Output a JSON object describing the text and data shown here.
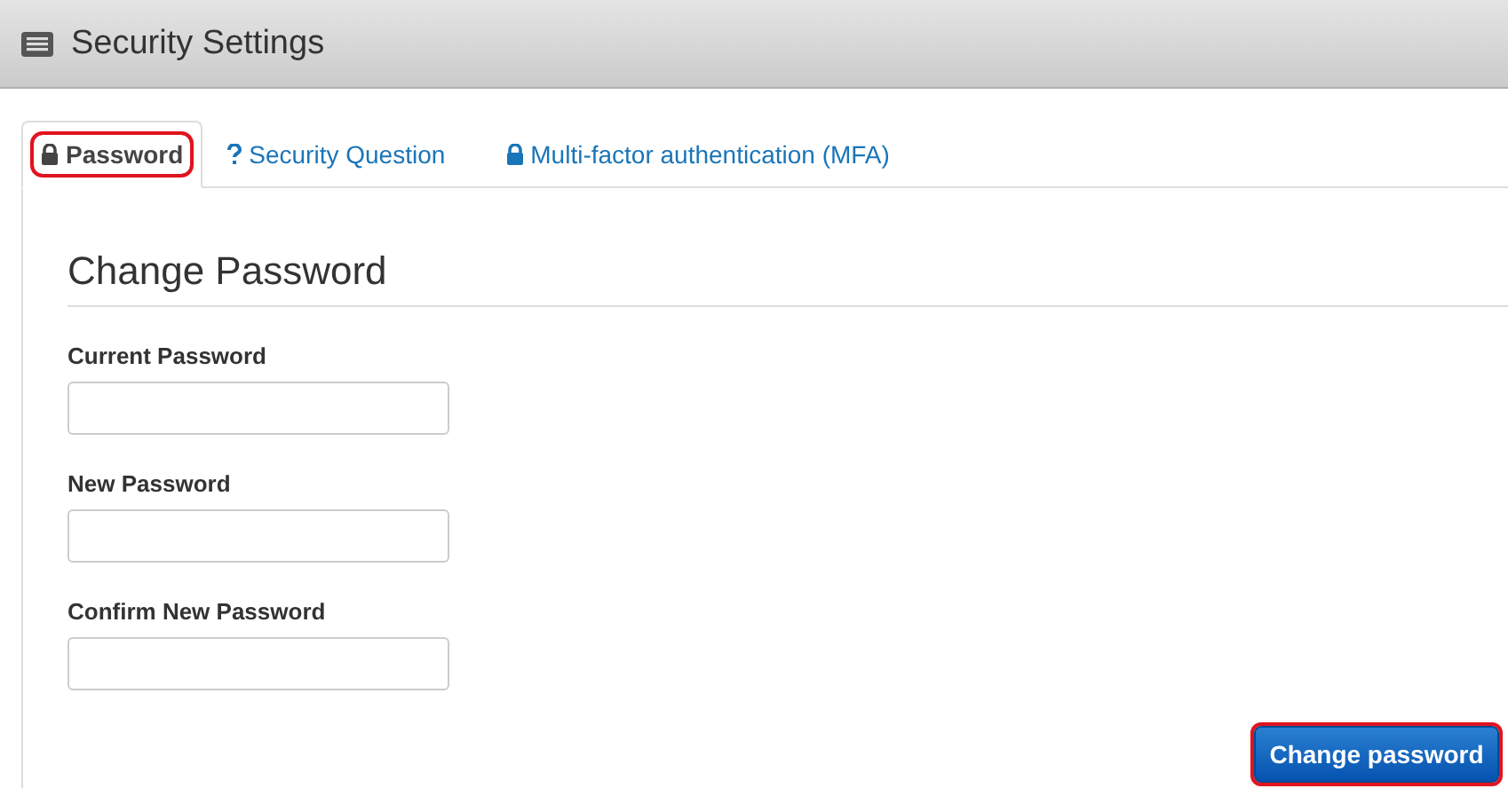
{
  "header": {
    "title": "Security Settings"
  },
  "tabs": [
    {
      "label": "Password",
      "kind": "lock",
      "selected": true,
      "highlighted": true
    },
    {
      "label": "Security Question",
      "kind": "question",
      "selected": false,
      "highlighted": false
    },
    {
      "label": "Multi-factor authentication (MFA)",
      "kind": "lock",
      "selected": false,
      "highlighted": false
    }
  ],
  "section_title": "Change Password",
  "fields": [
    {
      "label": "Current Password"
    },
    {
      "label": "New Password"
    },
    {
      "label": "Confirm New Password"
    }
  ],
  "submit": {
    "label": "Change password",
    "highlighted": true
  }
}
